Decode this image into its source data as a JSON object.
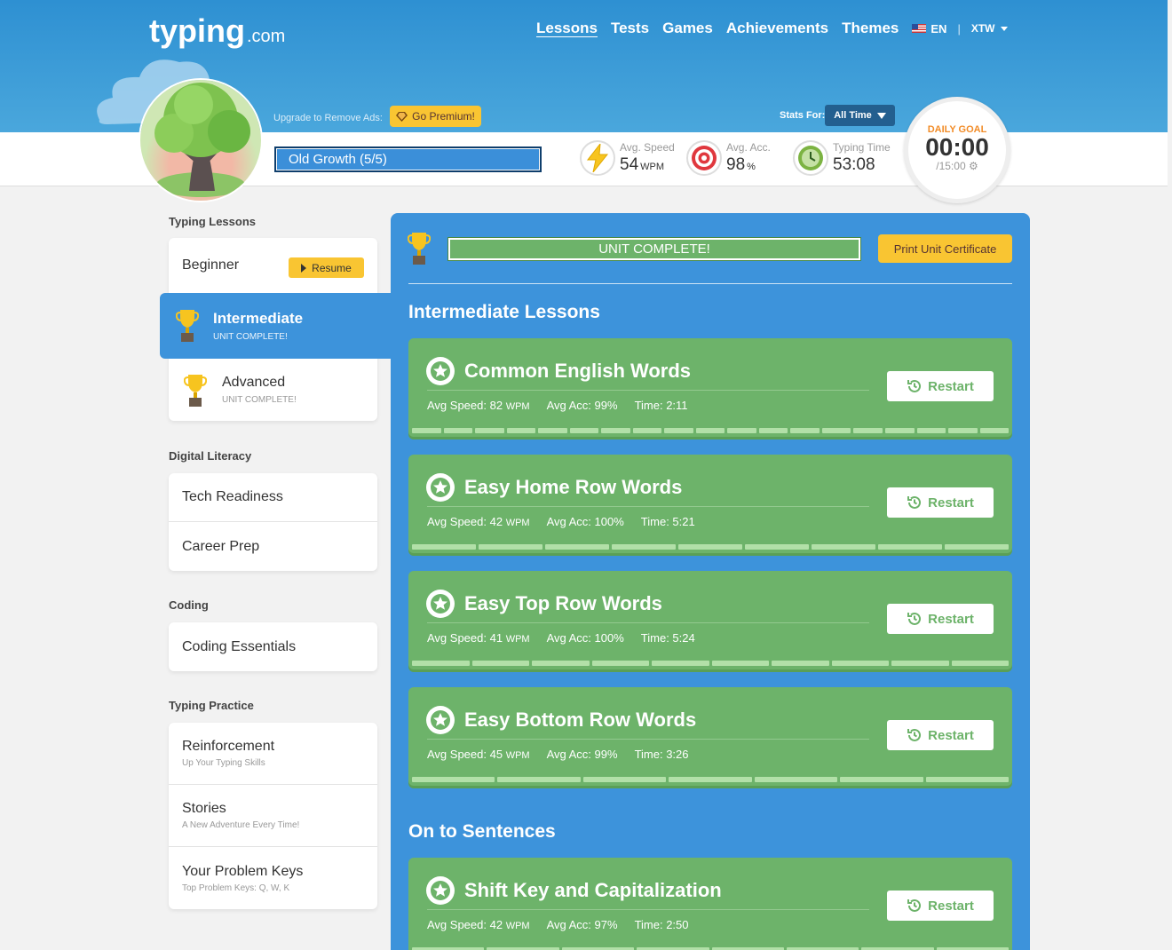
{
  "brand": {
    "name": "typing",
    "suffix": ".com"
  },
  "nav": {
    "items": [
      "Lessons",
      "Tests",
      "Games",
      "Achievements",
      "Themes"
    ],
    "active": "Lessons",
    "language": "EN",
    "user": "XTW"
  },
  "header": {
    "upgrade_text": "Upgrade to Remove Ads:",
    "premium_label": "Go Premium!",
    "stats_for_label": "Stats For:",
    "stats_for_value": "All Time"
  },
  "level": {
    "label": "Old Growth (5/5)"
  },
  "stats": {
    "speed": {
      "label": "Avg. Speed",
      "value": "54",
      "unit": "WPM"
    },
    "accuracy": {
      "label": "Avg. Acc.",
      "value": "98",
      "unit": "%"
    },
    "time": {
      "label": "Typing Time",
      "value": "53:08"
    }
  },
  "daily_goal": {
    "label": "DAILY GOAL",
    "time": "00:00",
    "target": "/15:00"
  },
  "sidebar": {
    "typing_lessons": {
      "title": "Typing Lessons",
      "beginner": "Beginner",
      "resume": "Resume",
      "intermediate": {
        "label": "Intermediate",
        "sub": "UNIT COMPLETE!"
      },
      "advanced": {
        "label": "Advanced",
        "sub": "UNIT COMPLETE!"
      }
    },
    "digital_literacy": {
      "title": "Digital Literacy",
      "items": [
        "Tech Readiness",
        "Career Prep"
      ]
    },
    "coding": {
      "title": "Coding",
      "items": [
        "Coding Essentials"
      ]
    },
    "typing_practice": {
      "title": "Typing Practice",
      "items": [
        {
          "label": "Reinforcement",
          "sub": "Up Your Typing Skills"
        },
        {
          "label": "Stories",
          "sub": "A New Adventure Every Time!"
        },
        {
          "label": "Your Problem Keys",
          "sub": "Top Problem Keys: Q, W, K"
        }
      ]
    }
  },
  "main": {
    "unit_status": "UNIT COMPLETE!",
    "cert_button": "Print Unit Certificate",
    "section1_title": "Intermediate Lessons",
    "section2_title": "On to Sentences",
    "restart_label": "Restart",
    "lessons": [
      {
        "name": "Common English Words",
        "speed": "Avg Speed: 82",
        "unit": "WPM",
        "acc": "Avg Acc: 99%",
        "time": "Time: 2:11",
        "segments": 19
      },
      {
        "name": "Easy Home Row Words",
        "speed": "Avg Speed: 42",
        "unit": "WPM",
        "acc": "Avg Acc: 100%",
        "time": "Time: 5:21",
        "segments": 9
      },
      {
        "name": "Easy Top Row Words",
        "speed": "Avg Speed: 41",
        "unit": "WPM",
        "acc": "Avg Acc: 100%",
        "time": "Time: 5:24",
        "segments": 10
      },
      {
        "name": "Easy Bottom Row Words",
        "speed": "Avg Speed: 45",
        "unit": "WPM",
        "acc": "Avg Acc: 99%",
        "time": "Time: 3:26",
        "segments": 7
      },
      {
        "name": "Shift Key and Capitalization",
        "speed": "Avg Speed: 42",
        "unit": "WPM",
        "acc": "Avg Acc: 97%",
        "time": "Time: 2:50",
        "segments": 8
      }
    ]
  },
  "colors": {
    "primary_blue": "#3d93db",
    "lesson_green": "#6db36a",
    "accent_yellow": "#f9c532",
    "goal_orange": "#f28c28"
  }
}
